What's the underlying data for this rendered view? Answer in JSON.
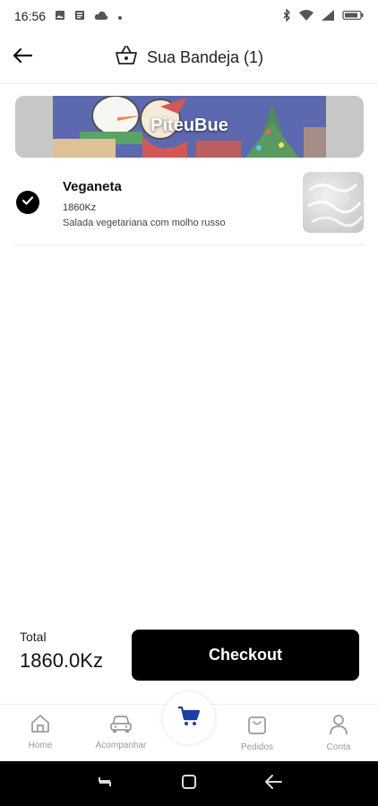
{
  "status_bar": {
    "time": "16:56",
    "left_icons": [
      "image-icon",
      "news-icon",
      "cloud-icon",
      "dot-icon"
    ],
    "right_icons": [
      "bluetooth-icon",
      "wifi-icon",
      "signal-icon",
      "battery-icon"
    ]
  },
  "header": {
    "title": "Sua Bandeja (1)",
    "back_icon": "arrow-left-icon",
    "basket_icon": "basket-icon"
  },
  "restaurant": {
    "name": "PiteuBue"
  },
  "cart": {
    "items": [
      {
        "selected": true,
        "name": "Veganeta",
        "price": "1860Kz",
        "description": "Salada vegetariana com molho russo"
      }
    ]
  },
  "summary": {
    "total_label": "Total",
    "total_value": "1860.0Kz",
    "checkout_label": "Checkout"
  },
  "bottom_nav": {
    "items": [
      {
        "label": "Home",
        "icon": "home-icon"
      },
      {
        "label": "Acompanhar",
        "icon": "car-icon"
      },
      {
        "label": "",
        "icon": "cart-icon",
        "active": true
      },
      {
        "label": "Pedidos",
        "icon": "shopping-bag-icon"
      },
      {
        "label": "Conta",
        "icon": "user-icon"
      }
    ]
  },
  "colors": {
    "accent": "#1a3fa0",
    "primary_button": "#000000",
    "nav_inactive": "#9a9a9a",
    "system_nav_bg": "#000000"
  }
}
